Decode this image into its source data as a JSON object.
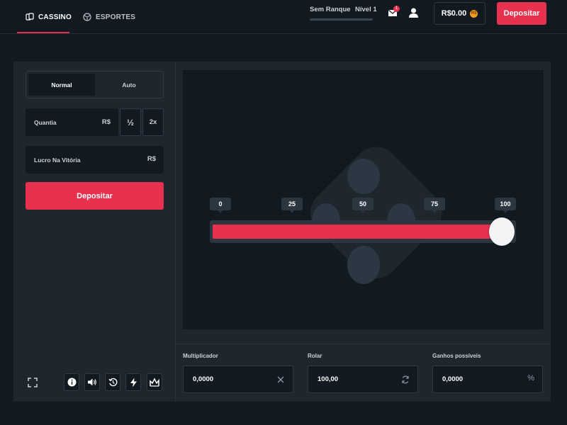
{
  "topbar": {
    "tabs": [
      {
        "label": "CASSINO",
        "icon": "cards-icon",
        "active": true
      },
      {
        "label": "ESPORTES",
        "icon": "ball-icon",
        "active": false
      }
    ],
    "rank_label": "Sem Ranque",
    "level_label": "Nível 1",
    "rank_progress": 0,
    "messages_badge": "1",
    "balance": "R$0.00",
    "coin_symbol": "R$",
    "deposit_label": "Depositar"
  },
  "controls": {
    "modes": [
      {
        "label": "Normal",
        "active": true
      },
      {
        "label": "Auto",
        "active": false
      }
    ],
    "amount": {
      "label": "Quantia",
      "currency": "R$",
      "half_label": "½",
      "double_label": "2x"
    },
    "profit": {
      "label": "Lucro Na Vitória",
      "currency": "R$"
    },
    "deposit_label": "Depositar",
    "bottom_icons": [
      "fullscreen-icon",
      "info-icon",
      "sound-icon",
      "history-icon",
      "lightning-icon",
      "stats-icon"
    ]
  },
  "game": {
    "slider_ticks": [
      "0",
      "25",
      "50",
      "75",
      "100"
    ],
    "slider_value": 100
  },
  "outputs": {
    "multiplier": {
      "label": "Multiplicador",
      "value": "0,0000",
      "icon": "close-icon"
    },
    "roll": {
      "label": "Rolar",
      "value": "100,00",
      "icon": "swap-icon"
    },
    "win_chance": {
      "label": "Ganhos possíveis",
      "value": "0,0000",
      "icon": "%"
    }
  },
  "colors": {
    "accent": "#e8304f",
    "background": "#121a21",
    "panel": "#1e262e",
    "coin": "#f39c1f"
  }
}
